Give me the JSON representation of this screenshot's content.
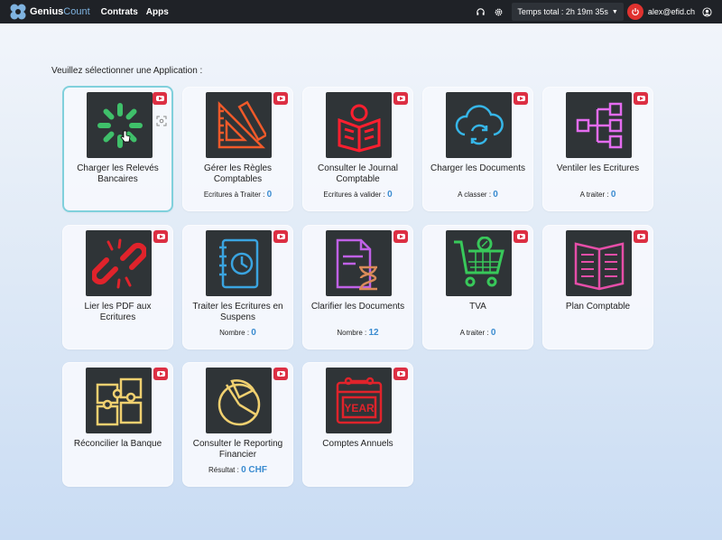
{
  "brand": {
    "name_bold": "Genius",
    "name_rest": "Count"
  },
  "nav": [
    {
      "label": "Contrats"
    },
    {
      "label": "Apps"
    }
  ],
  "header": {
    "timer": "Temps total : 2h 19m 35s",
    "user_email": "alex@efid.ch",
    "icons": [
      "headset-icon",
      "gear-icon",
      "power-icon",
      "user-circle-icon"
    ]
  },
  "page": {
    "heading": "Veuillez sélectionner une Application :"
  },
  "colors": {
    "topbar": "#1f2227",
    "accent": "#3a8bd0",
    "youtube": "#dc2f43",
    "selected_border": "#80d0dc"
  },
  "apps": [
    {
      "title": "Charger les Relevés Bancaires",
      "icon": "loading-spinner-icon",
      "selected": true
    },
    {
      "title": "Gérer les Règles Comptables",
      "stat_label": "Ecritures à Traiter :",
      "stat_value": "0",
      "icon": "ruler-triangle-icon"
    },
    {
      "title": "Consulter le Journal Comptable",
      "stat_label": "Ecritures à valider :",
      "stat_value": "0",
      "icon": "book-reader-icon"
    },
    {
      "title": "Charger les Documents",
      "stat_label": "A classer :",
      "stat_value": "0",
      "icon": "cloud-sync-icon"
    },
    {
      "title": "Ventiler les Ecritures",
      "stat_label": "A traiter :",
      "stat_value": "0",
      "icon": "hierarchy-icon"
    },
    {
      "title": "Lier les PDF aux Ecritures",
      "icon": "broken-link-icon"
    },
    {
      "title": "Traiter les Ecritures en Suspens",
      "stat_label": "Nombre :",
      "stat_value": "0",
      "icon": "notebook-clock-icon"
    },
    {
      "title": "Clarifier les Documents",
      "stat_label": "Nombre :",
      "stat_value": "12",
      "icon": "document-hourglass-icon"
    },
    {
      "title": "TVA",
      "stat_label": "A traiter :",
      "stat_value": "0",
      "icon": "shopping-cart-percent-icon"
    },
    {
      "title": "Plan Comptable",
      "icon": "newspaper-icon"
    },
    {
      "title": "Réconcilier la Banque",
      "icon": "puzzle-icon"
    },
    {
      "title": "Consulter le Reporting Financier",
      "stat_label": "Résultat :",
      "stat_value": "0 CHF",
      "icon": "pie-chart-icon"
    },
    {
      "title": "Comptes Annuels",
      "icon": "calendar-year-icon",
      "icon_text": "YEAR"
    }
  ]
}
